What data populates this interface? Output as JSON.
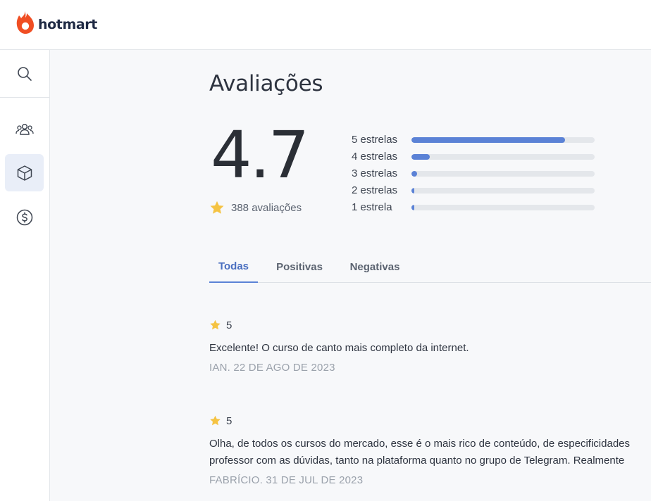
{
  "brand": {
    "name": "hotmart",
    "accent": "#f04e23",
    "text_color": "#1f2a44"
  },
  "sidebar": {
    "items": [
      {
        "icon": "search-icon",
        "active": false
      },
      {
        "icon": "users-icon",
        "active": false
      },
      {
        "icon": "product-box-icon",
        "active": true
      },
      {
        "icon": "dollar-icon",
        "active": false
      }
    ]
  },
  "page": {
    "title": "Avaliações"
  },
  "summary": {
    "average": "4.7",
    "count_label": "388 avaliações",
    "star_color": "#f5c342",
    "bar_color": "#5b82d6"
  },
  "distribution": [
    {
      "label": "5 estrelas",
      "fraction": 0.84
    },
    {
      "label": "4 estrelas",
      "fraction": 0.1
    },
    {
      "label": "3 estrelas",
      "fraction": 0.03
    },
    {
      "label": "2 estrelas",
      "fraction": 0.01
    },
    {
      "label": "1 estrela",
      "fraction": 0.01
    }
  ],
  "tabs": [
    {
      "label": "Todas",
      "active": true
    },
    {
      "label": "Positivas",
      "active": false
    },
    {
      "label": "Negativas",
      "active": false
    }
  ],
  "reviews": [
    {
      "rating": "5",
      "text": "Excelente! O curso de canto mais completo da internet.",
      "meta": "IAN. 22 DE AGO DE 2023"
    },
    {
      "rating": "5",
      "text_line1": "Olha, de todos os cursos do mercado, esse é o mais rico de conteúdo, de especificidades",
      "text_line2": "professor com as dúvidas, tanto na plataforma quanto no grupo de Telegram. Realmente",
      "meta": "FABRÍCIO. 31 DE JUL DE 2023"
    }
  ]
}
